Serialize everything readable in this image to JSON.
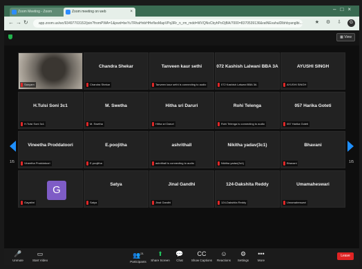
{
  "browser": {
    "tabs": [
      {
        "label": "Zoom Meeting - Zoom"
      },
      {
        "label": "Zoom meeting on web"
      }
    ],
    "url": "app.zoom.us/wc/93497703152/join?fromPWA=1&pwd=beYuTRhaHnbHHeflsoMapVPq3Rr_n_rm_mdd=WVQNxCbyhPoOjBA/7000=8370539136&ratNEvahulDlbhbyanglbi...",
    "avatar_letter": "G",
    "icons": [
      "back-icon",
      "forward-icon",
      "reload-icon",
      "star-icon",
      "extensions-icon",
      "menu-icon"
    ]
  },
  "zoom": {
    "view_label": "View",
    "page_left": "1/5",
    "page_right": "1/5",
    "participants": [
      {
        "name": "",
        "label": "Sanyam",
        "type": "video"
      },
      {
        "name": "Chandra Shekar",
        "label": "Chandra Shekar"
      },
      {
        "name": "Tanveen kaur sethi",
        "label": "Tanveen kaur sethi is connecting to audio"
      },
      {
        "name": "072 Kashish Lalwani BBA 3A",
        "label": "072 Kashish Lalwani BBA 3A"
      },
      {
        "name": "AYUSHI SINGH",
        "label": "AYUSHI SINGH"
      },
      {
        "name": "H.Tulsi Soni 3c1",
        "label": "H.Tulsi Soni 3c1"
      },
      {
        "name": "M. Swetha",
        "label": "M. Swetha"
      },
      {
        "name": "Hitha sri Daruri",
        "label": "Hitha sri Daruri"
      },
      {
        "name": "Rohi Telenga",
        "label": "Rohi Telenga is connecting to audio"
      },
      {
        "name": "057 Harika Goteti",
        "label": "057 Harika Goteti"
      },
      {
        "name": "Vineetha Proddatoori",
        "label": "Vineetha Proddatoori"
      },
      {
        "name": "E.poojitha",
        "label": "E.poojitha"
      },
      {
        "name": "ashrithall",
        "label": "ashrithall is connecting to audio"
      },
      {
        "name": "Nikitha yadav(3c1)",
        "label": "Nikitha yadav(3c1)"
      },
      {
        "name": "Bhavani",
        "label": "Bhavani"
      },
      {
        "name": "",
        "label": "Gayathri",
        "type": "avatar",
        "avatar": "G"
      },
      {
        "name": "Satya",
        "label": "Satya"
      },
      {
        "name": "Jinal Gandhi",
        "label": "Jinal Gandhi"
      },
      {
        "name": "124-Dakshita Reddy",
        "label": "124-Dakshita Reddy"
      },
      {
        "name": "Umamaheswari",
        "label": "Umamaheswari"
      }
    ],
    "toolbar": {
      "unmute": "Unmute",
      "start_video": "Start Video",
      "participants": "Participants",
      "participants_count": "21",
      "share_screen": "Share Screen",
      "chat": "Chat",
      "captions": "Show Captions",
      "reactions": "Reactions",
      "settings": "Settings",
      "more": "More",
      "leave": "Leave"
    },
    "colors": {
      "accent": "#1e8fff",
      "share": "#22c55e",
      "leave": "#e02424",
      "muted": "#e02828"
    }
  }
}
